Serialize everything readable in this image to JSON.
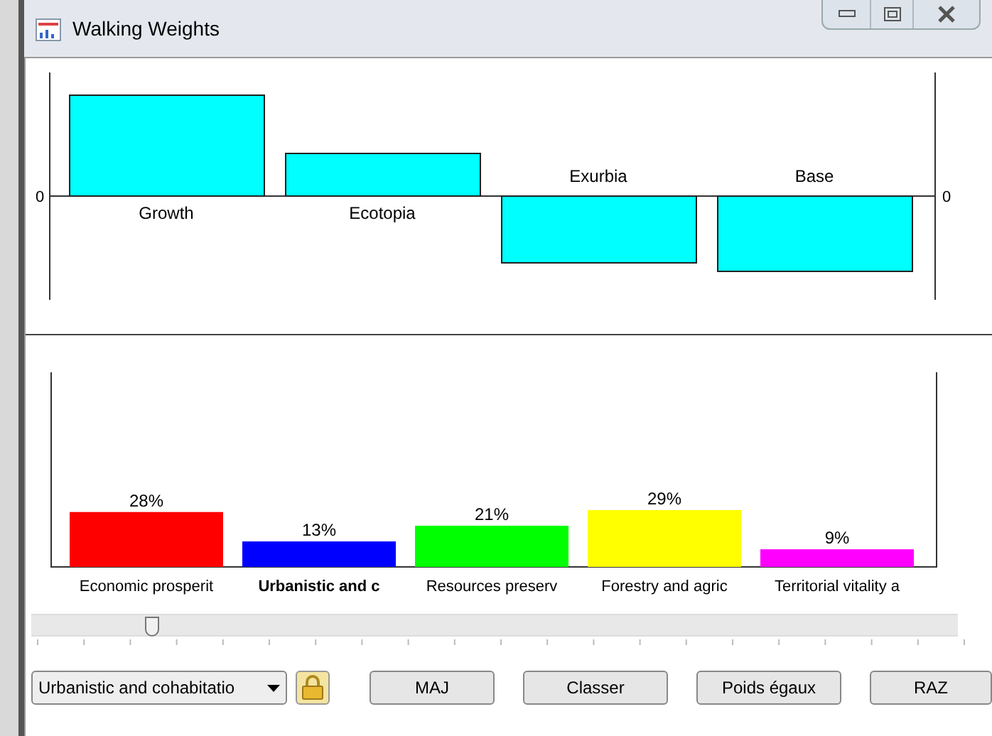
{
  "window": {
    "title": "Walking Weights"
  },
  "scenario_chart": {
    "zero_labels": [
      "0",
      "0"
    ],
    "scenarios": [
      {
        "label": "Growth"
      },
      {
        "label": "Ecotopia"
      },
      {
        "label": "Exurbia"
      },
      {
        "label": "Base"
      }
    ]
  },
  "weights_chart": {
    "chart_data": {
      "type": "bar",
      "categories": [
        "Economic prosperit",
        "Urbanistic and c",
        "Resources preserv",
        "Forestry and agric",
        "Territorial vitality a"
      ],
      "series": [
        {
          "values": [
            28,
            13,
            21,
            29,
            9
          ],
          "value_labels": [
            "28%",
            "13%",
            "21%",
            "29%",
            "9%"
          ]
        }
      ],
      "data_labels": true
    },
    "bars": [
      {
        "color": "#ff0000",
        "selected": false
      },
      {
        "color": "#0000ff",
        "selected": true
      },
      {
        "color": "#00ff00",
        "selected": false
      },
      {
        "color": "#ffff00",
        "selected": false
      },
      {
        "color": "#ff00ff",
        "selected": false
      }
    ]
  },
  "slider": {
    "level": 0.13
  },
  "criterion_select": {
    "value": "Urbanistic and cohabitatio"
  },
  "buttons": [
    "MAJ",
    "Classer",
    "Poids égaux",
    "RAZ"
  ]
}
